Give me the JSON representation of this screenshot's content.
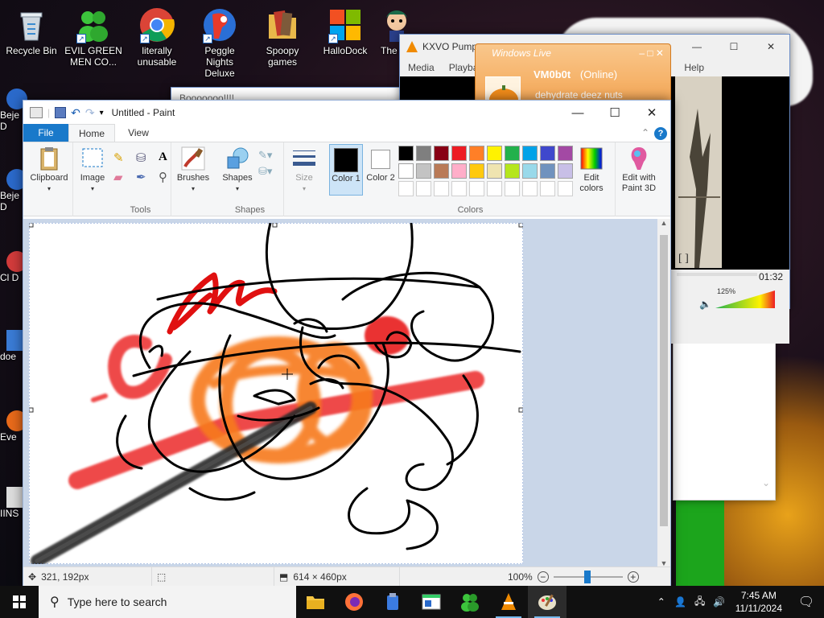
{
  "desktop": {
    "icons": [
      {
        "label": "Recycle Bin",
        "icon": "recycle-bin-icon"
      },
      {
        "label": "EVIL GREEN MEN CO...",
        "icon": "green-men-icon"
      },
      {
        "label": "literally unusable",
        "icon": "chrome-icon"
      },
      {
        "label": "Peggle Nights Deluxe",
        "icon": "peggle-icon"
      },
      {
        "label": "Spoopy games",
        "icon": "folder-icon"
      },
      {
        "label": "HalloDock",
        "icon": "windows-flag-icon"
      },
      {
        "label": "The of",
        "icon": "character-icon"
      }
    ],
    "left_partial_labels": [
      "Beje D",
      "Beje D",
      "Cl D",
      "doe",
      "Eve",
      "IINS"
    ]
  },
  "vlc": {
    "title": "KXVO Pump",
    "menu": [
      "Media",
      "Playba",
      "Help"
    ],
    "time": "01:32",
    "volume": "125%"
  },
  "windows_live": {
    "brand": "Windows Live",
    "user": "VM0b0t",
    "status": "(Online)",
    "message": "dehydrate deez nuts"
  },
  "behind_window": {
    "title": "Booooooo!!!!"
  },
  "paint": {
    "title": "Untitled - Paint",
    "tabs": {
      "file": "File",
      "home": "Home",
      "view": "View"
    },
    "ribbon": {
      "clipboard": "Clipboard",
      "image": "Image",
      "tools_group": "Tools",
      "brushes": "Brushes",
      "shapes": "Shapes",
      "shapes_group": "Shapes",
      "size": "Size",
      "color1": "Color 1",
      "color2": "Color 2",
      "colors_group": "Colors",
      "edit_colors": "Edit colors",
      "edit_paint3d": "Edit with Paint 3D"
    },
    "palette": [
      [
        "#000000",
        "#7f7f7f",
        "#880015",
        "#ed1c24",
        "#ff7f27",
        "#fff200",
        "#22b14c",
        "#00a2e8",
        "#3f48cc",
        "#a349a4"
      ],
      [
        "#ffffff",
        "#c3c3c3",
        "#b97a57",
        "#ffaec9",
        "#ffc90e",
        "#efe4b0",
        "#b5e61d",
        "#99d9ea",
        "#7092be",
        "#c8bfe7"
      ]
    ],
    "status": {
      "cursor_pos": "321, 192px",
      "image_size": "614 × 460px",
      "zoom": "100%"
    }
  },
  "taskbar": {
    "search_placeholder": "Type here to search",
    "time": "7:45 AM",
    "date": "11/11/2024"
  }
}
